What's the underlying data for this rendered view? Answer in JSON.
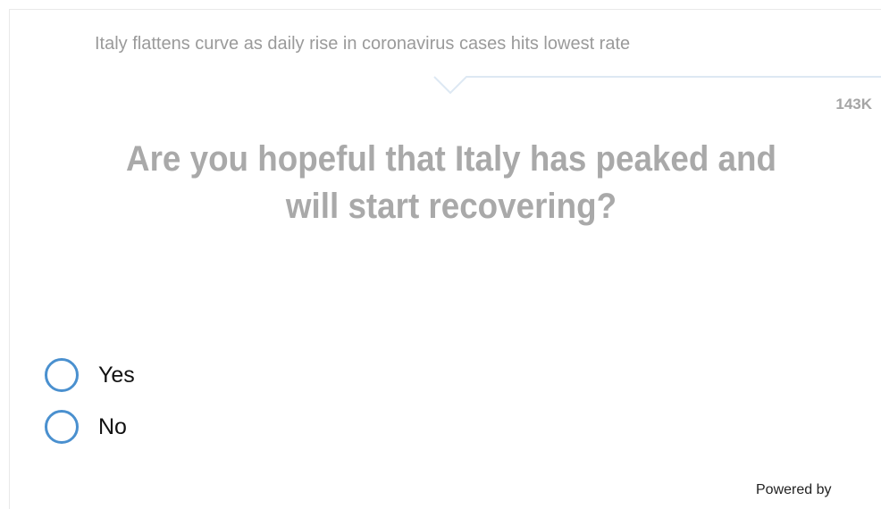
{
  "poll": {
    "headline": "Italy flattens curve as daily rise in coronavirus cases hits lowest rate",
    "vote_count": "143K",
    "question": "Are you hopeful that Italy has peaked and will start recovering?",
    "options": [
      {
        "label": "Yes"
      },
      {
        "label": "No"
      }
    ],
    "powered_by": "Powered by"
  },
  "colors": {
    "accent": "#4a90cf",
    "muted_text": "#9a9a9a",
    "divider": "#dde8f3"
  }
}
